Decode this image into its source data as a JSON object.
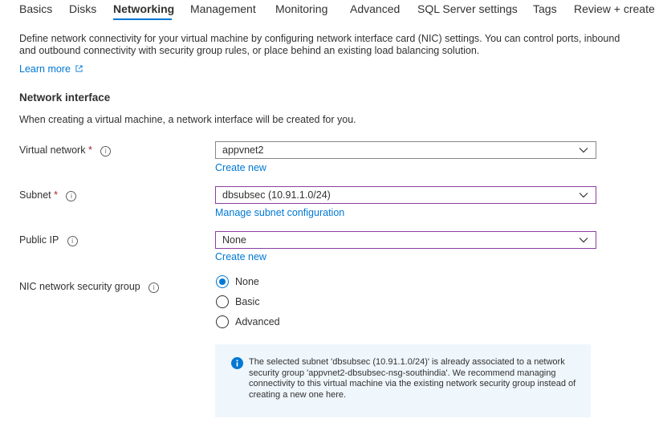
{
  "tabs": [
    {
      "label": "Basics"
    },
    {
      "label": "Disks"
    },
    {
      "label": "Networking"
    },
    {
      "label": "Management"
    },
    {
      "label": "Monitoring"
    },
    {
      "label": "Advanced"
    },
    {
      "label": "SQL Server settings"
    },
    {
      "label": "Tags"
    },
    {
      "label": "Review + create"
    }
  ],
  "active_tab": "Networking",
  "intro": {
    "text": "Define network connectivity for your virtual machine by configuring network interface card (NIC) settings. You can control ports, inbound and outbound connectivity with security group rules, or place behind an existing load balancing solution.",
    "learn_more": "Learn more",
    "learn_more_icon": "external-link-icon"
  },
  "network_interface": {
    "title": "Network interface",
    "description": "When creating a virtual machine, a network interface will be created for you."
  },
  "fields": {
    "virtual_network": {
      "label": "Virtual network",
      "required": "*",
      "value": "appvnet2",
      "link": "Create new"
    },
    "subnet": {
      "label": "Subnet",
      "required": "*",
      "value": "dbsubsec (10.91.1.0/24)",
      "link": "Manage subnet configuration"
    },
    "public_ip": {
      "label": "Public IP",
      "value": "None",
      "link": "Create new"
    },
    "nic_nsg": {
      "label": "NIC network security group",
      "options": [
        "None",
        "Basic",
        "Advanced"
      ],
      "selected": "None"
    }
  },
  "info_glyph": "i",
  "notice": {
    "icon": "info-filled-icon",
    "text": "The selected subnet 'dbsubsec (10.91.1.0/24)' is already associated to a network security group 'appvnet2-dbsubsec-nsg-southindia'. We recommend managing connectivity to this virtual machine via the existing network security group instead of creating a new one here."
  },
  "colors": {
    "accent": "#0078d4",
    "required": "#a4262c",
    "focus_border": "#8b3ea0",
    "notice_bg": "#eff6fc"
  }
}
